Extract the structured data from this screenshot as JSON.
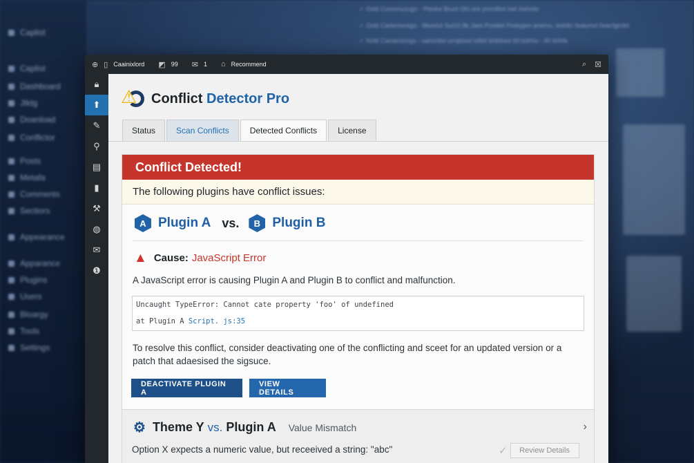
{
  "background": {
    "sidebar_items": [
      "Caplist",
      "Dashboard",
      "Jtktg",
      "Doanload",
      "Conflictor",
      "Posts",
      "Metafa",
      "Comments",
      "Sectiors",
      "Appearance",
      "Apparance",
      "Plugins",
      "Users",
      "Bloargy",
      "Tools",
      "Settings"
    ],
    "top_lines": [
      "✓ Ostti Cunnmuzugn - Pleolut Brunl Ohi ore ymroflint ioel ihehnto",
      "✓ Ostti Cartemorego - Muorlul Sut10.8k Jare Posiilet Finleypm anerns, ieshlin fealumd 0eacfginfet",
      "✓ Noltt Camerorings - sammlist ornjbreel loftel b0ethee 50.bdrhiv - 90 b0htk"
    ]
  },
  "topbar": {
    "username": "Caainixlord",
    "comments_count": "99",
    "messages_count": "1",
    "recommend_label": "Recommend"
  },
  "nav": {
    "items": [
      "lock-icon",
      "pin-icon",
      "brush-icon",
      "user-icon",
      "mail-icon",
      "page-icon",
      "tools-icon",
      "globe-icon",
      "envelope-icon",
      "info-icon"
    ],
    "active_index": 1
  },
  "header": {
    "title_main": "Conflict",
    "title_accent": "Detector Pro"
  },
  "tabs": [
    {
      "label": "Status",
      "state": "normal"
    },
    {
      "label": "Scan Conflicts",
      "state": "link"
    },
    {
      "label": "Detected Conflicts",
      "state": "active"
    },
    {
      "label": "License",
      "state": "normal"
    }
  ],
  "conflict": {
    "heading": "Conflict Detected!",
    "subheading": "The following plugins have conflict issues:",
    "plugin_a_badge": "A",
    "plugin_a": "Plugin A",
    "vs": "vs.",
    "plugin_b_badge": "B",
    "plugin_b": "Plugin B",
    "cause_label": "Cause:",
    "cause_value": "JavaScript Error",
    "description": "A JavaScript error is causing Plugin A and Plugin B to conflict and malfunction.",
    "code_line1": "Uncaught TypeError: Cannot cate property 'foo' of undefined",
    "code_line2_prefix": "at Plugin A ",
    "code_line2_highlight": "Script. js:35",
    "resolution": "To resolve this conflict, consider deactivating one of the conflicting and sceet for an updated version or a patch that adaesised the sigsuce.",
    "deactivate_button": "DEACTIVATE PLUGIN A",
    "view_button": "VIEW DETAILS"
  },
  "second_conflict": {
    "item_a": "Theme Y",
    "vs": "vs.",
    "item_b": "Plugin A",
    "type": "Value Mismatch",
    "message": "Option X expects a numeric value, but receeived a string: \"abc\"",
    "review_button": "Review Details"
  },
  "colors": {
    "alert_red": "#c6352b",
    "brand_blue": "#2163a8",
    "button_navy": "#1d4f89",
    "admin_dark": "#23282d"
  }
}
